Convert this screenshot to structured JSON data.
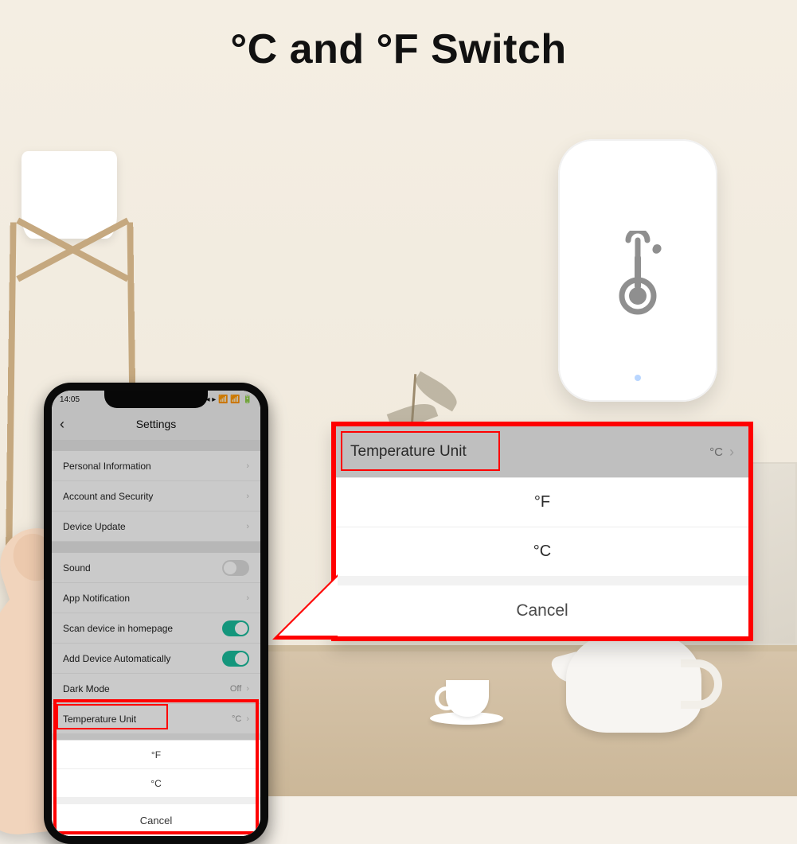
{
  "heading": "°C and °F Switch",
  "device": {
    "icon_name": "thermometer-icon"
  },
  "statusbar": {
    "time": "14:05",
    "icons": "◂ ▸  📶 📶 🔋"
  },
  "settings": {
    "title": "Settings",
    "items": [
      {
        "label": "Personal Information",
        "kind": "nav"
      },
      {
        "label": "Account and Security",
        "kind": "nav"
      },
      {
        "label": "Device Update",
        "kind": "nav"
      },
      {
        "label": "Sound",
        "kind": "toggle",
        "on": false
      },
      {
        "label": "App Notification",
        "kind": "nav"
      },
      {
        "label": "Scan device in homepage",
        "kind": "toggle",
        "on": true
      },
      {
        "label": "Add Device Automatically",
        "kind": "toggle",
        "on": true
      },
      {
        "label": "Dark Mode",
        "kind": "value",
        "value": "Off"
      },
      {
        "label": "Temperature Unit",
        "kind": "value",
        "value": "°C"
      }
    ]
  },
  "picker": {
    "options": [
      "°F",
      "°C"
    ],
    "cancel": "Cancel"
  },
  "callout": {
    "row_label": "Temperature Unit",
    "row_value": "°C",
    "options": [
      "°F",
      "°C"
    ],
    "cancel": "Cancel"
  }
}
